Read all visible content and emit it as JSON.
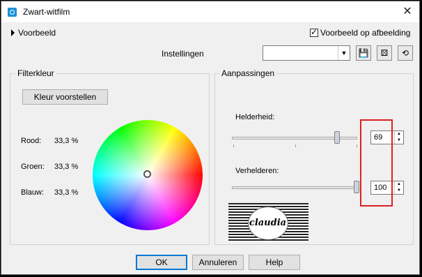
{
  "window": {
    "title": "Zwart-witfilm"
  },
  "preview": {
    "toggle_label": "Voorbeeld",
    "check_label": "Voorbeeld op afbeelding",
    "checked": true
  },
  "settings": {
    "label": "Instellingen",
    "preset_value": ""
  },
  "toolbar_icons": [
    "save-preset-icon",
    "randomize-icon",
    "reset-icon"
  ],
  "filter_color": {
    "group_label": "Filterkleur",
    "suggest_button": "Kleur voorstellen",
    "channels": [
      {
        "name": "Rood:",
        "value": "33,3 %"
      },
      {
        "name": "Groen:",
        "value": "33,3 %"
      },
      {
        "name": "Blauw:",
        "value": "33,3 %"
      }
    ]
  },
  "adjustments": {
    "group_label": "Aanpassingen",
    "brightness": {
      "label": "Helderheid:",
      "value": "69"
    },
    "clarify": {
      "label": "Verhelderen:",
      "value": "100"
    }
  },
  "watermark": {
    "text": "claudia"
  },
  "buttons": {
    "ok": "OK",
    "cancel": "Annuleren",
    "help": "Help"
  },
  "colors": {
    "window_bg": "#f0f0f0",
    "highlight": "#e02020",
    "ok_focus": "#0078d7"
  }
}
